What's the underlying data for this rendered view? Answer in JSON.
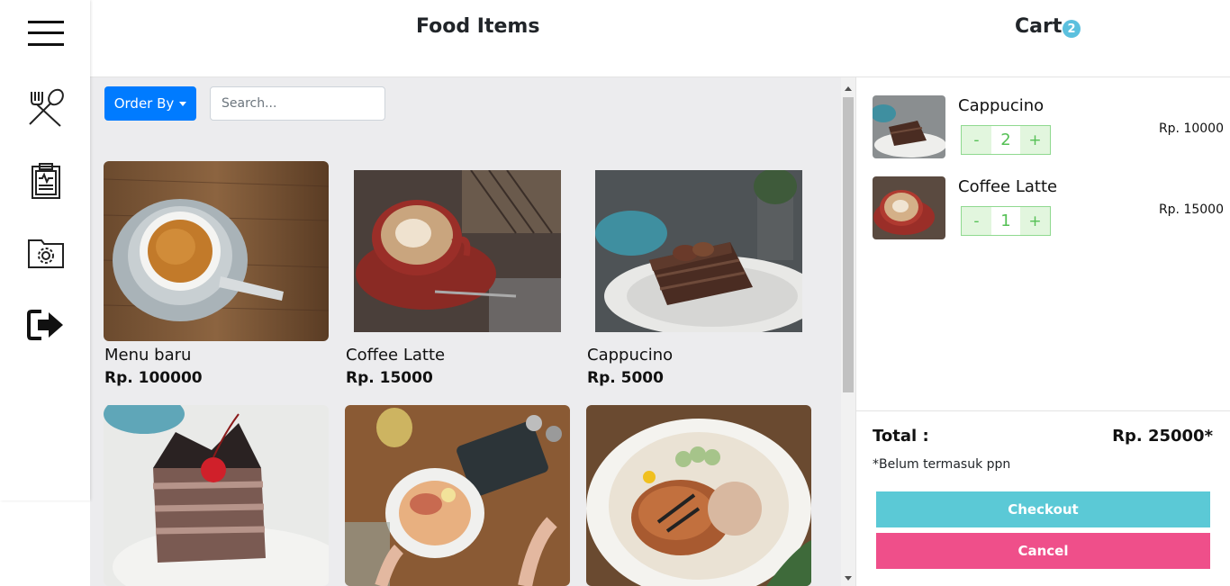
{
  "header": {
    "food_title": "Food Items",
    "cart_title": "Cart",
    "cart_count": "2"
  },
  "sidebar": {
    "icons": [
      "menu-icon",
      "utensils-icon",
      "clipboard-icon",
      "settings-folder-icon",
      "logout-icon"
    ]
  },
  "toolbar": {
    "order_by_label": "Order By",
    "search_placeholder": "Search..."
  },
  "food_items": [
    {
      "name": "Menu baru",
      "price": "Rp. 100000"
    },
    {
      "name": "Coffee Latte",
      "price": "Rp. 15000"
    },
    {
      "name": "Cappucino",
      "price": "Rp. 5000"
    },
    {
      "name": "",
      "price": ""
    },
    {
      "name": "",
      "price": ""
    },
    {
      "name": "",
      "price": ""
    }
  ],
  "cart": {
    "items": [
      {
        "name": "Cappucino",
        "qty": "2",
        "price": "Rp. 10000",
        "minus": "-",
        "plus": "+"
      },
      {
        "name": "Coffee Latte",
        "qty": "1",
        "price": "Rp. 15000",
        "minus": "-",
        "plus": "+"
      }
    ],
    "total_label": "Total :",
    "total_value": "Rp. 25000*",
    "tax_note": "*Belum termasuk ppn",
    "checkout_label": "Checkout",
    "cancel_label": "Cancel"
  },
  "colors": {
    "primary": "#007bff",
    "info": "#5bc9d6",
    "danger": "#ef4f8a",
    "success": "#55c055"
  }
}
